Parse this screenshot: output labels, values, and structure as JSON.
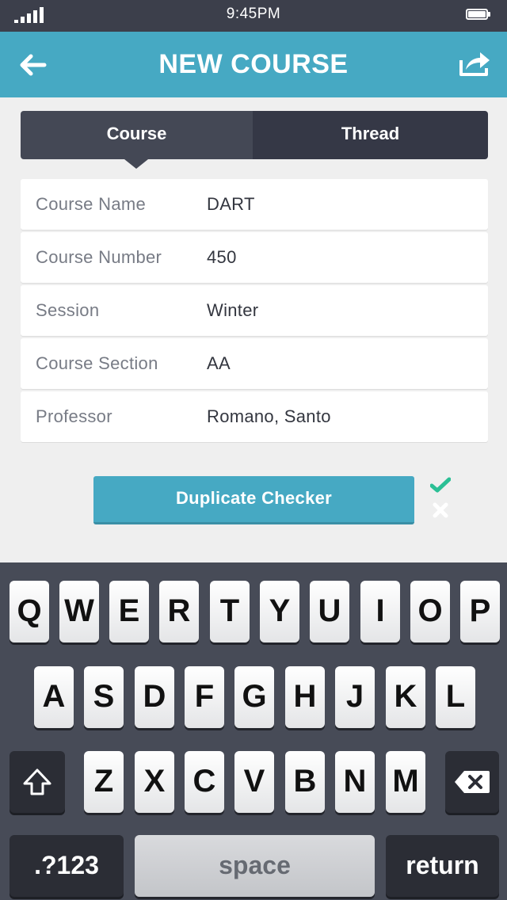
{
  "status_bar": {
    "time": "9:45PM"
  },
  "header": {
    "title": "NEW COURSE"
  },
  "tabs": [
    {
      "label": "Course",
      "active": true
    },
    {
      "label": "Thread",
      "active": false
    }
  ],
  "form": {
    "rows": [
      {
        "label": "Course Name",
        "value": "DART"
      },
      {
        "label": "Course Number",
        "value": "450"
      },
      {
        "label": "Session",
        "value": "Winter"
      },
      {
        "label": "Course Section",
        "value": "AA"
      },
      {
        "label": "Professor",
        "value": "Romano, Santo"
      }
    ]
  },
  "duplicate_checker": {
    "label": "Duplicate Checker"
  },
  "colors": {
    "accent": "#46a9c3",
    "status_bar": "#3c3f4b",
    "keyboard": "#474b57",
    "check": "#2bbf95"
  },
  "keyboard": {
    "row1": [
      "Q",
      "W",
      "E",
      "R",
      "T",
      "Y",
      "U",
      "I",
      "O",
      "P"
    ],
    "row2": [
      "A",
      "S",
      "D",
      "F",
      "G",
      "H",
      "J",
      "K",
      "L"
    ],
    "row3": [
      "Z",
      "X",
      "C",
      "V",
      "B",
      "N",
      "M"
    ],
    "numbers_label": ".?123",
    "space_label": "space",
    "return_label": "return"
  },
  "icons": {
    "back": "arrow-left-icon",
    "share": "share-icon",
    "check": "checkmark-icon",
    "reject": "x-icon",
    "shift": "shift-arrow-icon",
    "delete": "backspace-icon"
  }
}
